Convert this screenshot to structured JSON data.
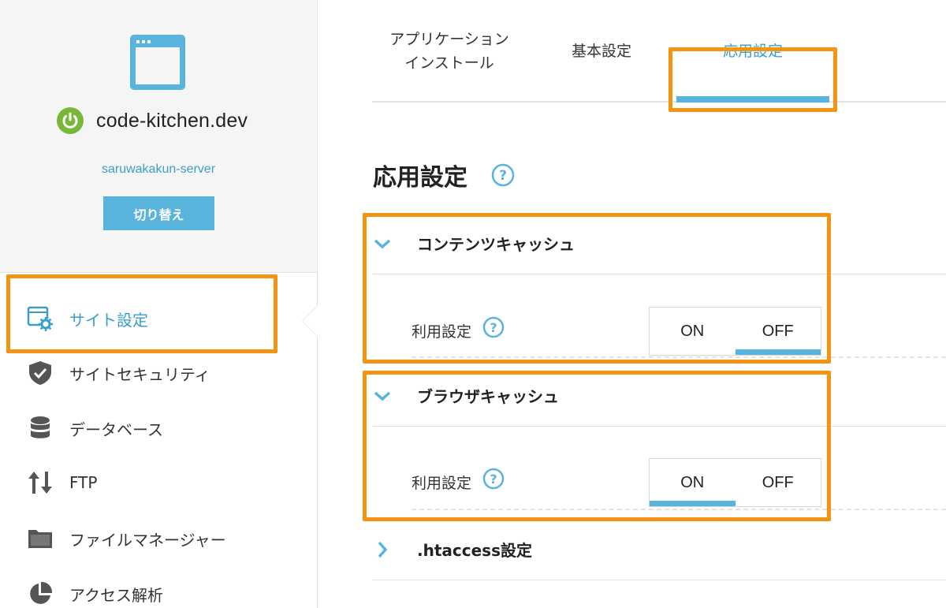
{
  "site": {
    "name": "code-kitchen.dev",
    "server": "saruwakakun-server",
    "switch_label": "切り替え"
  },
  "sidebar": {
    "items": [
      {
        "label": "サイト設定",
        "icon": "site-settings-icon",
        "active": true
      },
      {
        "label": "サイトセキュリティ",
        "icon": "shield-icon",
        "active": false
      },
      {
        "label": "データベース",
        "icon": "database-icon",
        "active": false
      },
      {
        "label": "FTP",
        "icon": "transfer-arrows-icon",
        "active": false
      },
      {
        "label": "ファイルマネージャー",
        "icon": "folder-icon",
        "active": false
      },
      {
        "label": "アクセス解析",
        "icon": "pie-chart-icon",
        "active": false
      }
    ]
  },
  "tabs": [
    {
      "line1": "アプリケーション",
      "line2": "インストール",
      "active": false
    },
    {
      "line1": "基本設定",
      "line2": "",
      "active": false
    },
    {
      "line1": "応用設定",
      "line2": "",
      "active": true
    }
  ],
  "main": {
    "title": "応用設定",
    "sections": [
      {
        "title": "コンテンツキャッシュ",
        "expanded": true,
        "setting_label": "利用設定",
        "on_label": "ON",
        "off_label": "OFF",
        "value": "OFF"
      },
      {
        "title": "ブラウザキャッシュ",
        "expanded": true,
        "setting_label": "利用設定",
        "on_label": "ON",
        "off_label": "OFF",
        "value": "ON"
      },
      {
        "title": ".htaccess設定",
        "expanded": false
      }
    ]
  },
  "colors": {
    "accent": "#58b4dc",
    "accent_text": "#3a9fc8",
    "highlight": "#f39512",
    "power_green": "#7ab639"
  }
}
